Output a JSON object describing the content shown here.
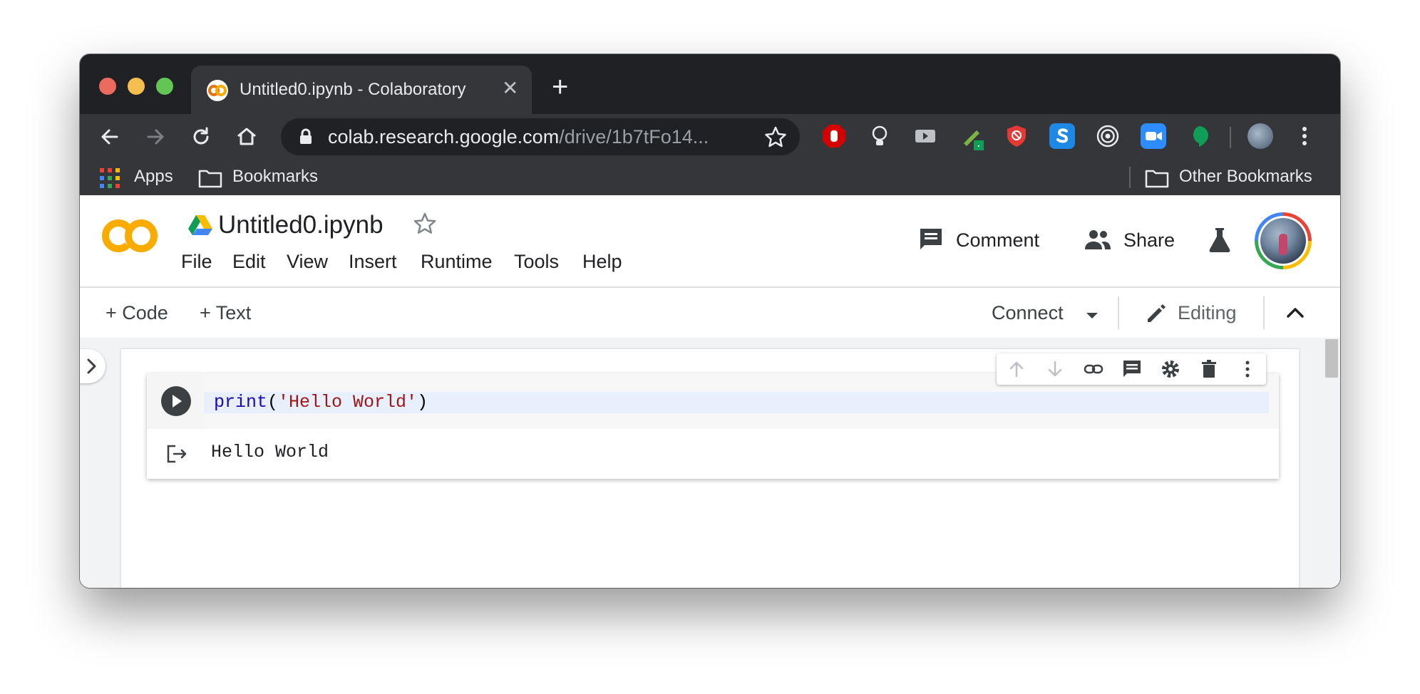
{
  "browser": {
    "tab_title": "Untitled0.ipynb - Colaboratory",
    "tab_favicon": "colab-favicon",
    "url_host": "colab.research.google.com",
    "url_path": "/drive/1b7tFo14...",
    "nav_icons": [
      "back-icon",
      "forward-icon",
      "reload-icon",
      "home-icon"
    ],
    "extensions": [
      "adblock-hand-icon",
      "bulb-icon",
      "video-icon",
      "eyedropper-icon",
      "shield-block-icon",
      "skype-icon",
      "target-icon",
      "zoom-icon",
      "hangouts-icon"
    ],
    "bookmarks": {
      "apps": "Apps",
      "bookmarks": "Bookmarks",
      "other": "Other Bookmarks"
    }
  },
  "colab": {
    "notebook_title": "Untitled0.ipynb",
    "menu": [
      "File",
      "Edit",
      "View",
      "Insert",
      "Runtime",
      "Tools",
      "Help"
    ],
    "comment_label": "Comment",
    "share_label": "Share",
    "add_code": "+ Code",
    "add_text": "+ Text",
    "connect_label": "Connect",
    "editing_label": "Editing",
    "cell": {
      "code_fn": "print",
      "code_open": "(",
      "code_string": "'Hello World'",
      "code_close": ")",
      "output": "Hello World"
    }
  },
  "colors": {
    "chrome_dark": "#202124",
    "chrome_toolbar": "#35363a",
    "colab_orange": "#f9ab00",
    "code_keyword": "#1a0dab",
    "code_string": "#a31515"
  }
}
